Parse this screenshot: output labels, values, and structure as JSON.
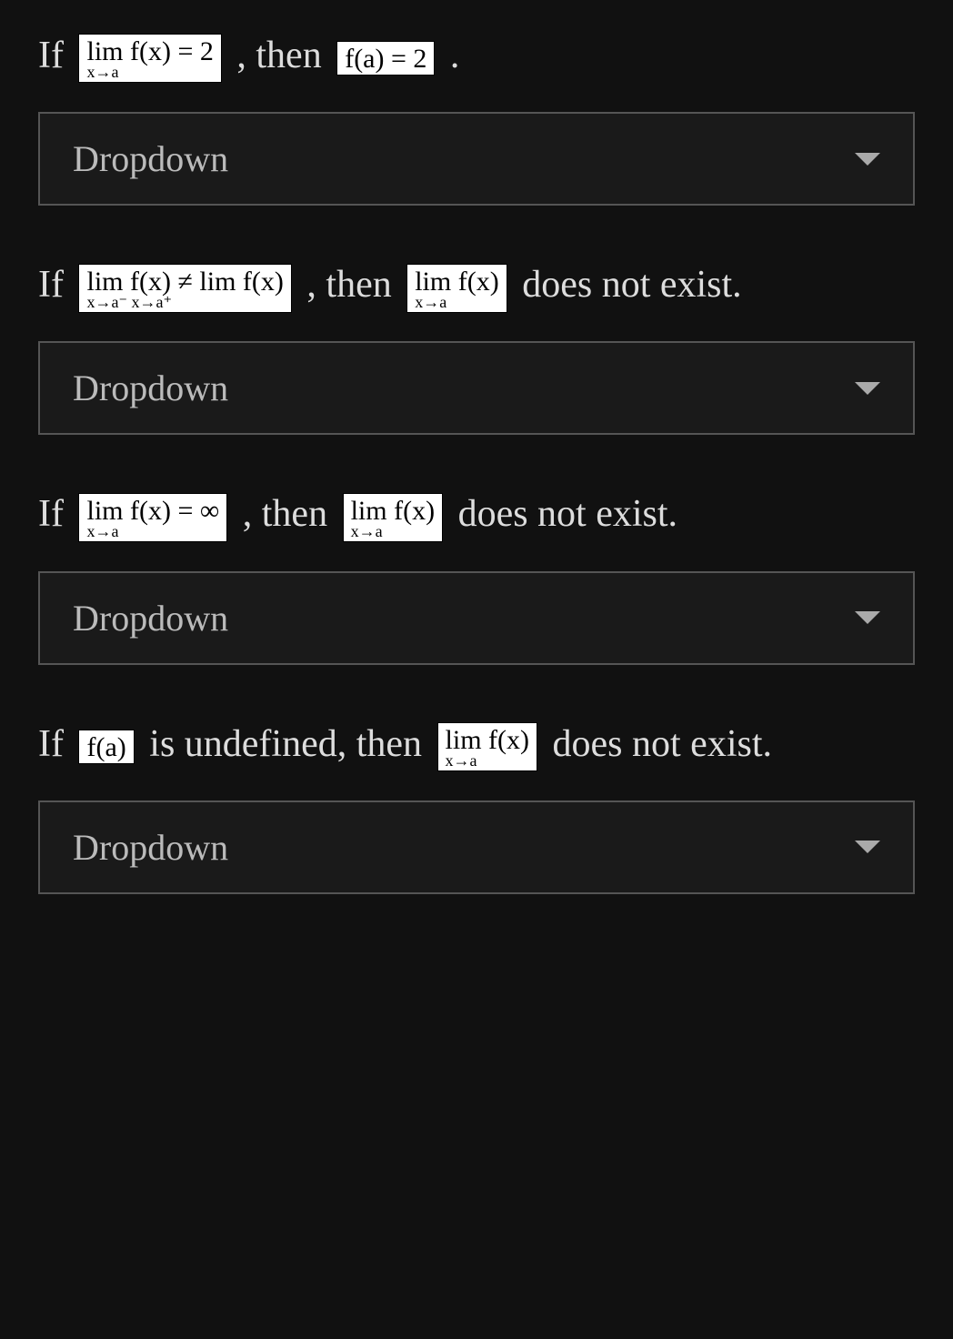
{
  "dropdown_placeholder": "Dropdown",
  "questions": [
    {
      "pre": "If ",
      "math1_top": "lim f(x) = 2",
      "math1_bot": "x→a",
      "mid": " , then ",
      "math2_single": "f(a) = 2",
      "post": " ."
    },
    {
      "pre": "If ",
      "math1_top": "lim  f(x) ≠  lim  f(x)",
      "math1_bot": "x→a⁻            x→a⁺",
      "mid": " , then ",
      "math2_top": "lim f(x)",
      "math2_bot": "x→a",
      "post": " does not exist."
    },
    {
      "pre": "If ",
      "math1_top": "lim f(x) = ∞",
      "math1_bot": "x→a",
      "mid": " , then ",
      "math2_top": "lim f(x)",
      "math2_bot": "x→a",
      "post": " does not exist."
    },
    {
      "pre": "If ",
      "math1_single": "f(a)",
      "mid": " is undefined, then ",
      "math2_top": "lim f(x)",
      "math2_bot": "x→a",
      "post": " does not exist."
    }
  ]
}
